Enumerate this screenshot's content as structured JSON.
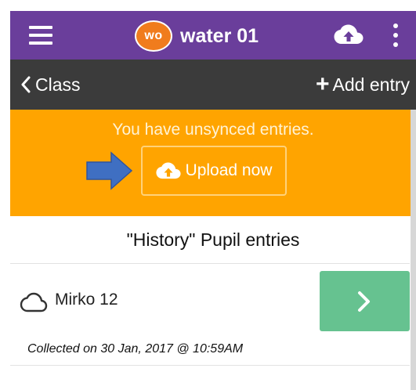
{
  "appbar": {
    "avatar_text": "wo",
    "title": "water 01",
    "menu_icon": "hamburger-menu-icon",
    "cloud_icon": "cloud-upload-icon",
    "overflow_icon": "kebab-menu-icon",
    "color": "#6a3e9b",
    "avatar_color": "#f07c1d"
  },
  "subbar": {
    "back_label": "Class",
    "add_label": "Add entry",
    "color": "#3b3b3b"
  },
  "banner": {
    "message": "You have unsynced entries.",
    "upload_label": "Upload now",
    "color": "#ffa400",
    "arrow_color": "#3f6fc2"
  },
  "section": {
    "title": "\"History\" Pupil entries"
  },
  "entries": [
    {
      "name": "Mirko 12",
      "collected": "Collected on 30 Jan, 2017 @ 10:59AM",
      "status_icon": "cloud-outline-icon",
      "button_color": "#66c290"
    }
  ]
}
